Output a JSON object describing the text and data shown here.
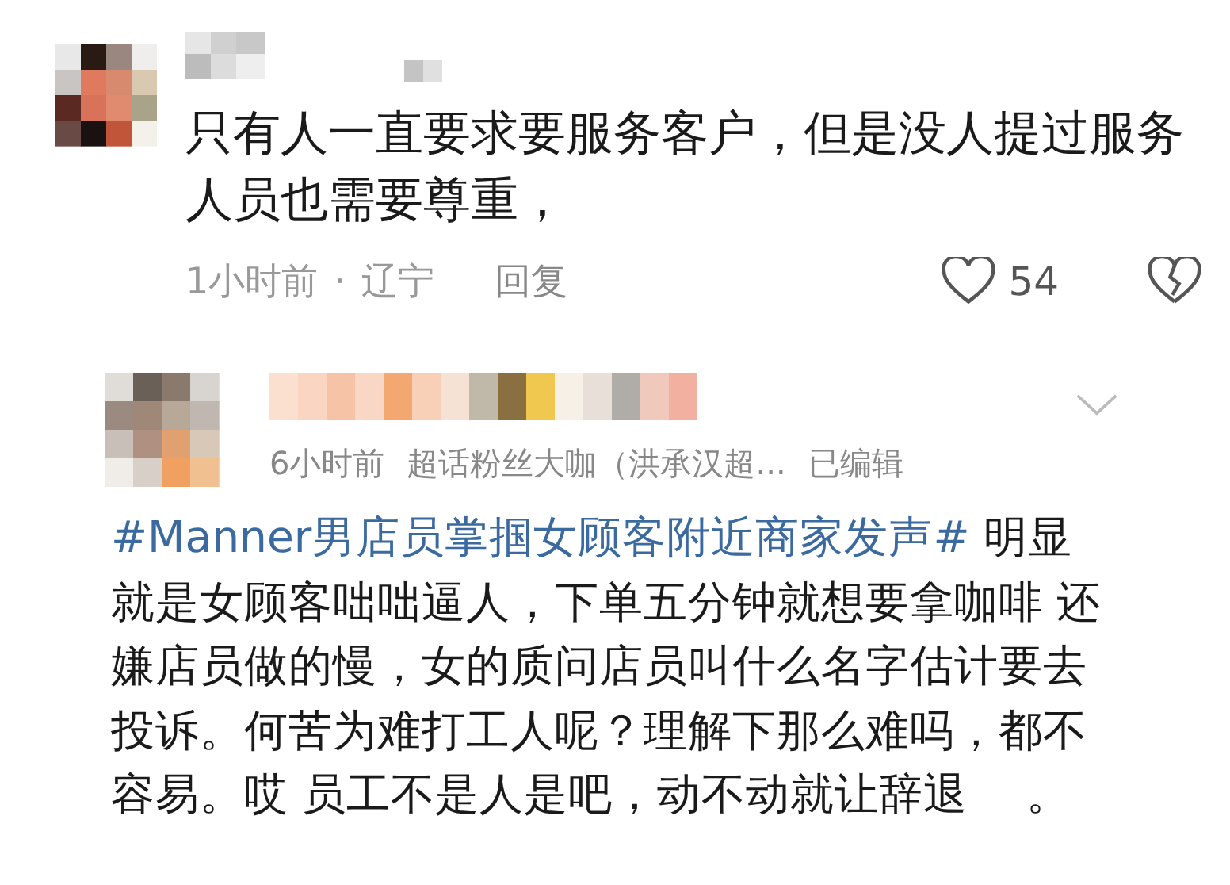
{
  "comments": [
    {
      "text": "只有人一直要求要服务客户，但是没人提过服务人员也需要尊重，",
      "meta": [
        "1小时前",
        "·",
        "辽宁"
      ],
      "reply": "回复",
      "likes": "54",
      "liked": false
    },
    {
      "meta": [
        "6小时前",
        "超话粉丝大咖（洪承汉超...",
        "已编辑"
      ],
      "hashtag": "#Manner男店员掌掴女顾客附近商家发声#",
      "text": " 明显就是女顾客咄咄逼人，下单五分钟就想要拿咖啡 还嫌店员做的慢，女的质问店员叫什么名字估计要去投诉。何苦为难打工人呢？理解下那么难吗，都不容易。哎 员工不是人是吧，动不动就让辞退　 。"
    }
  ]
}
